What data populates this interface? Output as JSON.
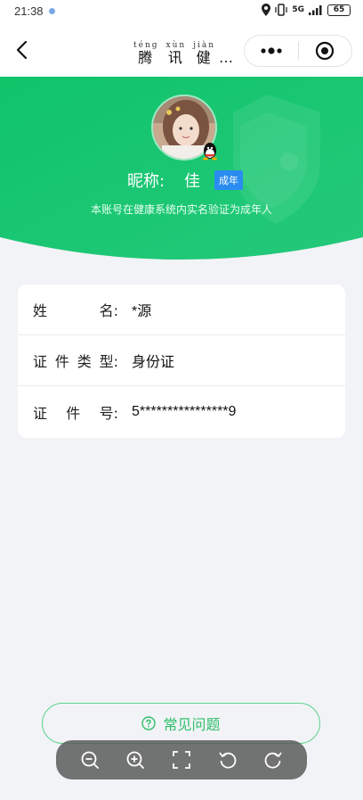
{
  "status": {
    "time": "21:38",
    "network": "5G",
    "battery": "65"
  },
  "nav": {
    "title_chars": [
      {
        "pinyin": "téng",
        "hanzi": "腾"
      },
      {
        "pinyin": "xùn",
        "hanzi": "讯"
      },
      {
        "pinyin": "jiàn",
        "hanzi": "健"
      }
    ],
    "title_ellipsis": "…"
  },
  "profile": {
    "nickname_label": "昵称:",
    "nickname_value": "佳",
    "age_badge": "成年",
    "verify_text": "本账号在健康系统内实名验证为成年人"
  },
  "info": {
    "name_label_chars": [
      "姓",
      "名:"
    ],
    "name_value": "*源",
    "idtype_label_chars": [
      "证",
      "件",
      "类",
      "型:"
    ],
    "idtype_value": "身份证",
    "idnum_label_chars": [
      "证",
      "件",
      "号:"
    ],
    "idnum_value": "5****************9"
  },
  "faq": {
    "label": "常见问题"
  },
  "colors": {
    "brand_green": "#1fc46f",
    "badge_blue": "#2a8cf0"
  },
  "icons": {
    "back": "chevron-left-icon",
    "more": "more-dots-icon",
    "close": "target-circle-icon",
    "faq": "question-circle-icon",
    "zoom_out": "zoom-out-icon",
    "zoom_in": "zoom-in-icon",
    "fullscreen": "fullscreen-icon",
    "rotate_left": "rotate-left-icon",
    "rotate_right": "rotate-right-icon"
  }
}
